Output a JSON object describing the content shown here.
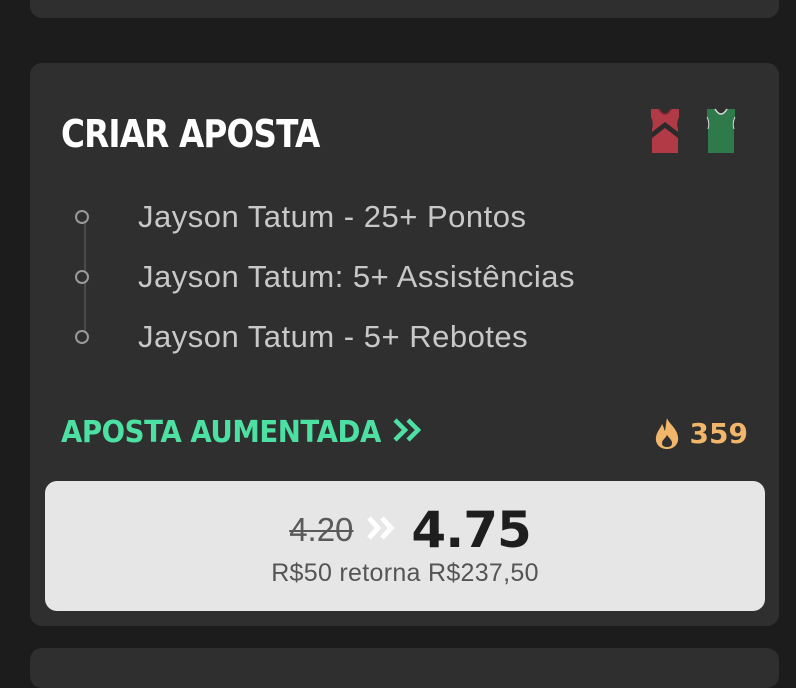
{
  "card": {
    "title": "CRIAR APOSTA",
    "jerseys": [
      {
        "team_color": "#b03a45",
        "accent_color": "#2a2a2a",
        "icon": "jersey-icon"
      },
      {
        "team_color": "#2e7a4a",
        "accent_color": "#2e7a4a",
        "icon": "jersey-icon"
      }
    ],
    "legs": [
      {
        "label": "Jayson Tatum - 25+ Pontos"
      },
      {
        "label": "Jayson Tatum: 5+ Assistências"
      },
      {
        "label": "Jayson Tatum - 5+ Rebotes"
      }
    ],
    "boost": {
      "label": "APOSTA AUMENTADA",
      "icon": "double-chevron-right-icon",
      "color": "#4ce0a3"
    },
    "popularity": {
      "icon": "fire-icon",
      "count": "359",
      "color": "#f2b66a"
    },
    "odds": {
      "old": "4.20",
      "new": "4.75",
      "arrow_icon": "double-chevron-right-icon",
      "returns": "R$50 retorna R$237,50"
    }
  }
}
